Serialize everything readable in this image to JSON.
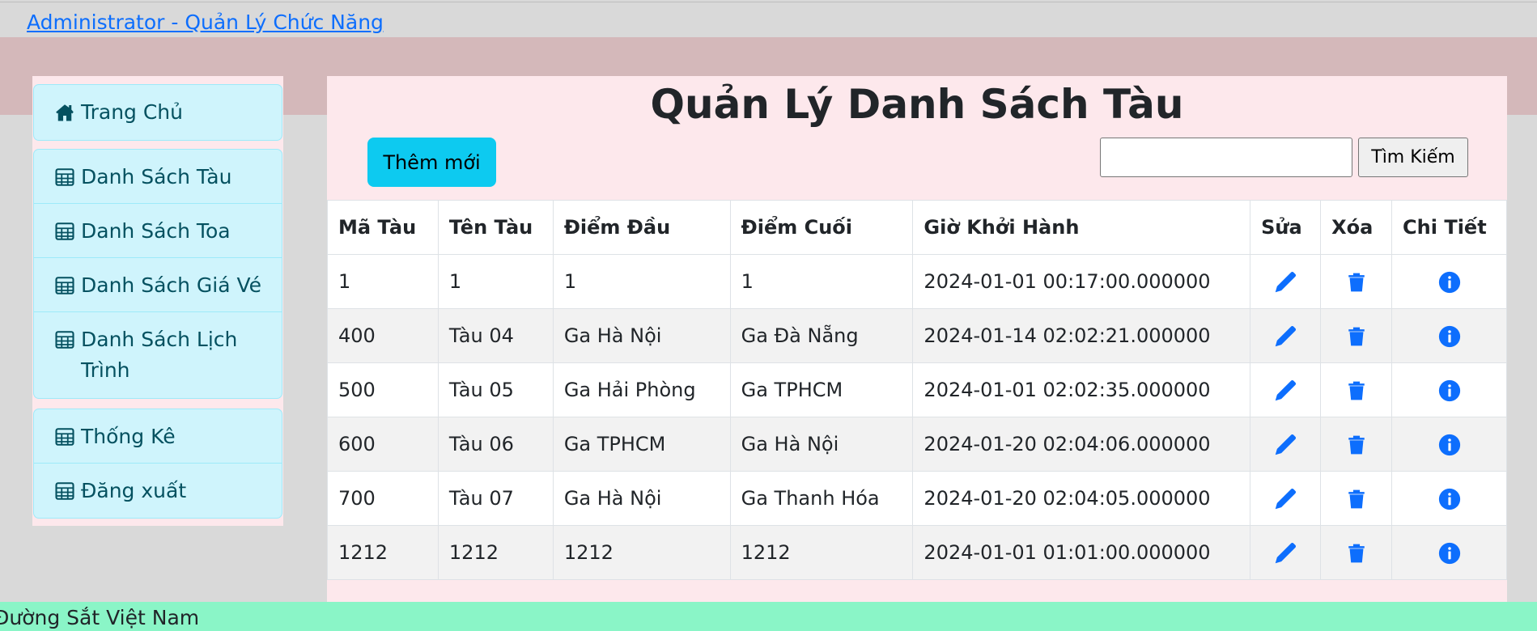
{
  "header": {
    "title_link": "Administrator - Quản Lý Chức Năng"
  },
  "sidebar": {
    "groups": [
      {
        "items": [
          {
            "label": "Trang Chủ",
            "icon": "house-icon"
          }
        ]
      },
      {
        "items": [
          {
            "label": "Danh Sách Tàu",
            "icon": "table-icon"
          },
          {
            "label": "Danh Sách Toa",
            "icon": "table-icon"
          },
          {
            "label": "Danh Sách Giá Vé",
            "icon": "table-icon"
          },
          {
            "label": "Danh Sách Lịch Trình",
            "icon": "table-icon"
          }
        ]
      },
      {
        "items": [
          {
            "label": "Thống Kê",
            "icon": "table-icon"
          },
          {
            "label": "Đăng xuất",
            "icon": "table-icon"
          }
        ]
      }
    ]
  },
  "main": {
    "title": "Quản Lý Danh Sách Tàu",
    "add_button": "Thêm mới",
    "search": {
      "value": "",
      "button": "Tìm Kiếm"
    },
    "table": {
      "headers": [
        "Mã Tàu",
        "Tên Tàu",
        "Điểm Đầu",
        "Điểm Cuối",
        "Giờ Khởi Hành",
        "Sửa",
        "Xóa",
        "Chi Tiết"
      ],
      "rows": [
        [
          "1",
          "1",
          "1",
          "1",
          "2024-01-01 00:17:00.000000"
        ],
        [
          "400",
          "Tàu 04",
          "Ga Hà Nội",
          "Ga Đà Nẵng",
          "2024-01-14 02:02:21.000000"
        ],
        [
          "500",
          "Tàu 05",
          "Ga Hải Phòng",
          "Ga TPHCM",
          "2024-01-01 02:02:35.000000"
        ],
        [
          "600",
          "Tàu 06",
          "Ga TPHCM",
          "Ga Hà Nội",
          "2024-01-20 02:04:06.000000"
        ],
        [
          "700",
          "Tàu 07",
          "Ga Hà Nội",
          "Ga Thanh Hóa",
          "2024-01-20 02:04:05.000000"
        ],
        [
          "1212",
          "1212",
          "1212",
          "1212",
          "2024-01-01 01:01:00.000000"
        ]
      ],
      "action_icons": [
        "pencil-icon",
        "trash-icon",
        "info-circle-icon"
      ]
    }
  },
  "footer": {
    "text": "Đường Sắt Việt Nam"
  },
  "colors": {
    "link": "#0d6efd",
    "band": "#d4b8ba",
    "panel": "#fde8ec",
    "sidebar_item": "#cff4fc",
    "sidebar_text": "#055160",
    "add_button": "#0dcaf0",
    "footer": "#8af5c7",
    "icon": "#0d6efd"
  }
}
